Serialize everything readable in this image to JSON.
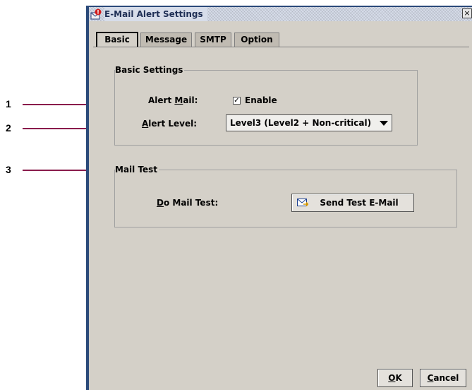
{
  "callouts": [
    "1",
    "2",
    "3"
  ],
  "window": {
    "title": "E-Mail Alert Settings",
    "close_glyph": "×"
  },
  "tabs": [
    {
      "label": "Basic",
      "active": true
    },
    {
      "label": "Message",
      "active": false
    },
    {
      "label": "SMTP",
      "active": false
    },
    {
      "label": "Option",
      "active": false
    }
  ],
  "basic_settings": {
    "group_title": "Basic Settings",
    "alert_mail": {
      "label_prefix": "Alert ",
      "label_mnemonic": "M",
      "label_suffix": "ail:",
      "checkbox_label": "Enable",
      "checked": true
    },
    "alert_level": {
      "label_mnemonic": "A",
      "label_suffix": "lert Level:",
      "selected": "Level3 (Level2 + Non-critical)"
    }
  },
  "mail_test": {
    "group_title": "Mail Test",
    "label_mnemonic": "D",
    "label_suffix": "o Mail Test:",
    "button_label": "Send Test E-Mail"
  },
  "footer": {
    "ok_mnemonic": "O",
    "ok_suffix": "K",
    "cancel_mnemonic": "C",
    "cancel_suffix": "ancel"
  },
  "icons": {
    "title": "mail-alert-icon",
    "close": "close-icon",
    "send": "mail-send-icon",
    "dropdown": "chevron-down-icon"
  },
  "colors": {
    "callout_line": "#8a1c4c",
    "window_frame": "#2b4a7a",
    "panel": "#d4d0c8"
  }
}
